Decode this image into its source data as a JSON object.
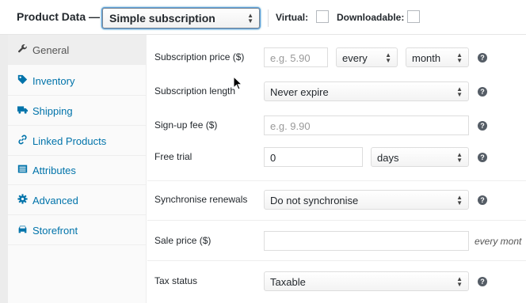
{
  "header": {
    "title": "Product Data —",
    "product_type": "Simple subscription",
    "virtual_label": "Virtual:",
    "downloadable_label": "Downloadable:"
  },
  "tabs": [
    {
      "label": "General",
      "icon": "wrench-icon",
      "active": true
    },
    {
      "label": "Inventory",
      "icon": "tag-icon",
      "active": false
    },
    {
      "label": "Shipping",
      "icon": "truck-icon",
      "active": false
    },
    {
      "label": "Linked Products",
      "icon": "link-icon",
      "active": false
    },
    {
      "label": "Attributes",
      "icon": "list-icon",
      "active": false
    },
    {
      "label": "Advanced",
      "icon": "gear-icon",
      "active": false
    },
    {
      "label": "Storefront",
      "icon": "car-icon",
      "active": false
    }
  ],
  "fields": {
    "subscription_price": {
      "label": "Subscription price ($)",
      "placeholder": "e.g. 5.90",
      "interval": "every",
      "period": "month"
    },
    "subscription_length": {
      "label": "Subscription length",
      "value": "Never expire"
    },
    "signup_fee": {
      "label": "Sign-up fee ($)",
      "placeholder": "e.g. 9.90"
    },
    "free_trial": {
      "label": "Free trial",
      "value": "0",
      "period": "days"
    },
    "synchronise": {
      "label": "Synchronise renewals",
      "value": "Do not synchronise"
    },
    "sale_price": {
      "label": "Sale price ($)",
      "placeholder": "",
      "suffix": "every mont"
    },
    "tax_status": {
      "label": "Tax status",
      "value": "Taxable"
    }
  },
  "colors": {
    "link": "#0073aa",
    "focus": "#5b9dd9",
    "help_icon": "#555d66"
  }
}
